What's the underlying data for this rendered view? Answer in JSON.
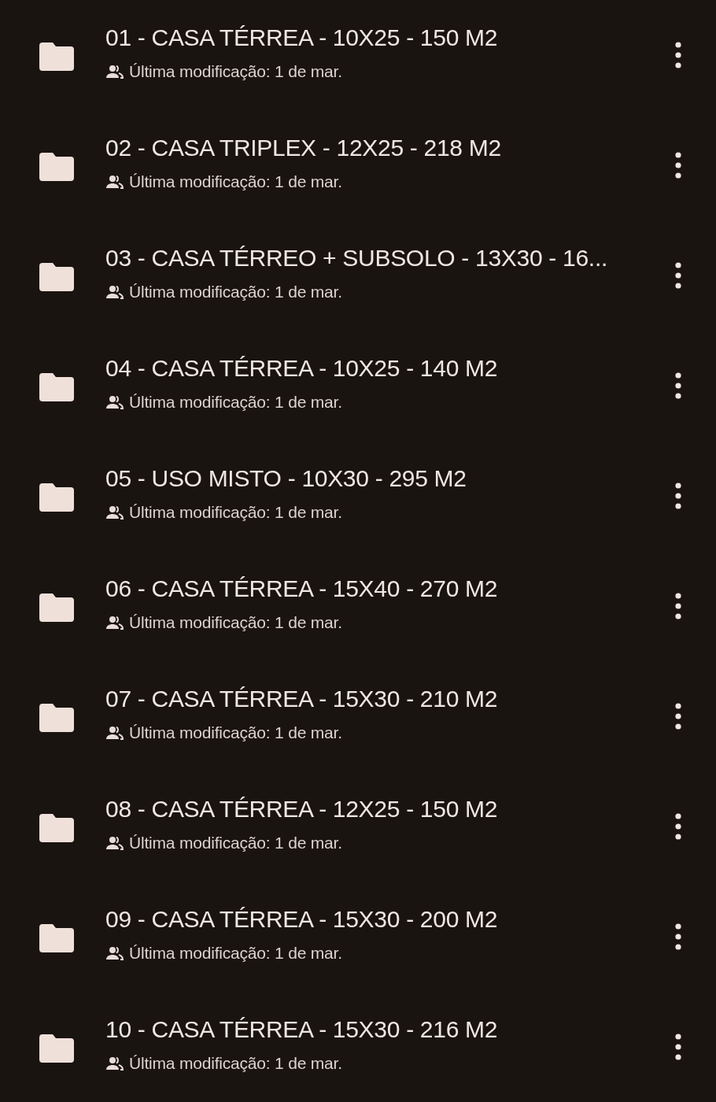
{
  "files": [
    {
      "title": "01 - CASA TÉRREA - 10X25 - 150 M2",
      "subtitle": "Última modificação: 1 de mar."
    },
    {
      "title": "02 - CASA TRIPLEX - 12X25 - 218 M2",
      "subtitle": "Última modificação: 1 de mar."
    },
    {
      "title": "03 - CASA TÉRREO + SUBSOLO - 13X30 - 16...",
      "subtitle": "Última modificação: 1 de mar."
    },
    {
      "title": "04 - CASA TÉRREA - 10X25 - 140 M2",
      "subtitle": "Última modificação: 1 de mar."
    },
    {
      "title": "05 - USO MISTO - 10X30 - 295 M2",
      "subtitle": "Última modificação: 1 de mar."
    },
    {
      "title": "06 - CASA TÉRREA - 15X40 - 270 M2",
      "subtitle": "Última modificação: 1 de mar."
    },
    {
      "title": "07 - CASA TÉRREA - 15X30 - 210 M2",
      "subtitle": "Última modificação: 1 de mar."
    },
    {
      "title": "08 - CASA TÉRREA - 12X25 - 150 M2",
      "subtitle": "Última modificação: 1 de mar."
    },
    {
      "title": "09 - CASA TÉRREA - 15X30 - 200 M2",
      "subtitle": "Última modificação: 1 de mar."
    },
    {
      "title": "10 - CASA TÉRREA - 15X30 - 216 M2",
      "subtitle": "Última modificação: 1 de mar."
    }
  ]
}
